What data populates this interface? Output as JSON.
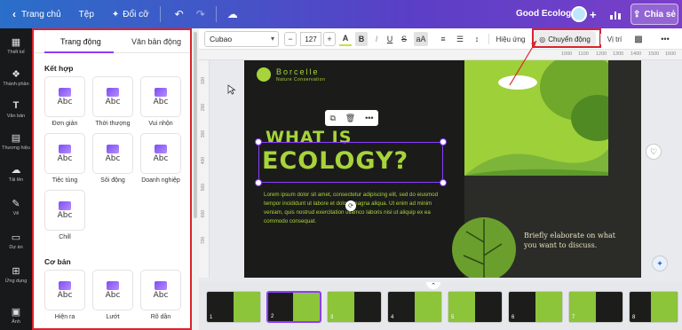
{
  "topbar": {
    "home": "Trang chủ",
    "file": "Tệp",
    "resize": "Đổi cỡ",
    "doc_title": "Good Ecology",
    "share": "Chia sẻ"
  },
  "rail": [
    {
      "label": "Thiết kế",
      "icon": "layout-icon"
    },
    {
      "label": "Thành phần",
      "icon": "elements-icon"
    },
    {
      "label": "Văn bản",
      "icon": "text-icon"
    },
    {
      "label": "Thương hiệu",
      "icon": "brand-icon"
    },
    {
      "label": "Tải lên",
      "icon": "upload-icon"
    },
    {
      "label": "Vẽ",
      "icon": "draw-icon"
    },
    {
      "label": "Dự án",
      "icon": "projects-icon"
    },
    {
      "label": "Ứng dụng",
      "icon": "apps-icon"
    },
    {
      "label": "Ảnh",
      "icon": "photos-icon"
    }
  ],
  "panel": {
    "tabs": [
      "Trang động",
      "Văn bản động"
    ],
    "section1": "Kết hợp",
    "section2": "Cơ bản",
    "animations1": [
      "Đơn giản",
      "Thời thượng",
      "Vui nhộn",
      "Tiệc tùng",
      "Sôi động",
      "Doanh nghiệp",
      "Chill"
    ],
    "animations2": [
      "Hiện ra",
      "Lướt",
      "Rõ dần"
    ],
    "card_text": "Abc"
  },
  "toolbar": {
    "font": "Cubao",
    "font_size": "127",
    "effects": "Hiệu ứng",
    "motion": "Chuyển động",
    "position": "Vị trí"
  },
  "rulers": {
    "top": [
      "1000",
      "1100",
      "1200",
      "1300",
      "1400",
      "1500",
      "1600",
      "1700",
      "1800",
      "1900"
    ],
    "left": [
      "100",
      "200",
      "300",
      "400",
      "500",
      "600",
      "700",
      "800",
      "900"
    ]
  },
  "slide": {
    "brand": "Borcelle",
    "brand_sub": "Nature Conservation",
    "headline1": "WHAT IS",
    "headline2": "ECOLOGY?",
    "body": "Lorem ipsum dolor sit amet, consectetur adipiscing elit, sed do eiusmod tempor incididunt ut labore et dolore magna aliqua. Ut enim ad minim veniam, quis nostrud exercitation ullamco laboris nisi ut aliquip ex ea commodo consequat.",
    "side_text": "Briefly elaborate on what you want to discuss."
  },
  "thumbnails": [
    "1",
    "2",
    "3",
    "4",
    "5",
    "6",
    "7",
    "8"
  ],
  "colors": {
    "accent": "#8b3dff",
    "highlight": "#d9232d",
    "slide_green": "#a7d43a",
    "slide_dark": "#1b1c1a"
  }
}
